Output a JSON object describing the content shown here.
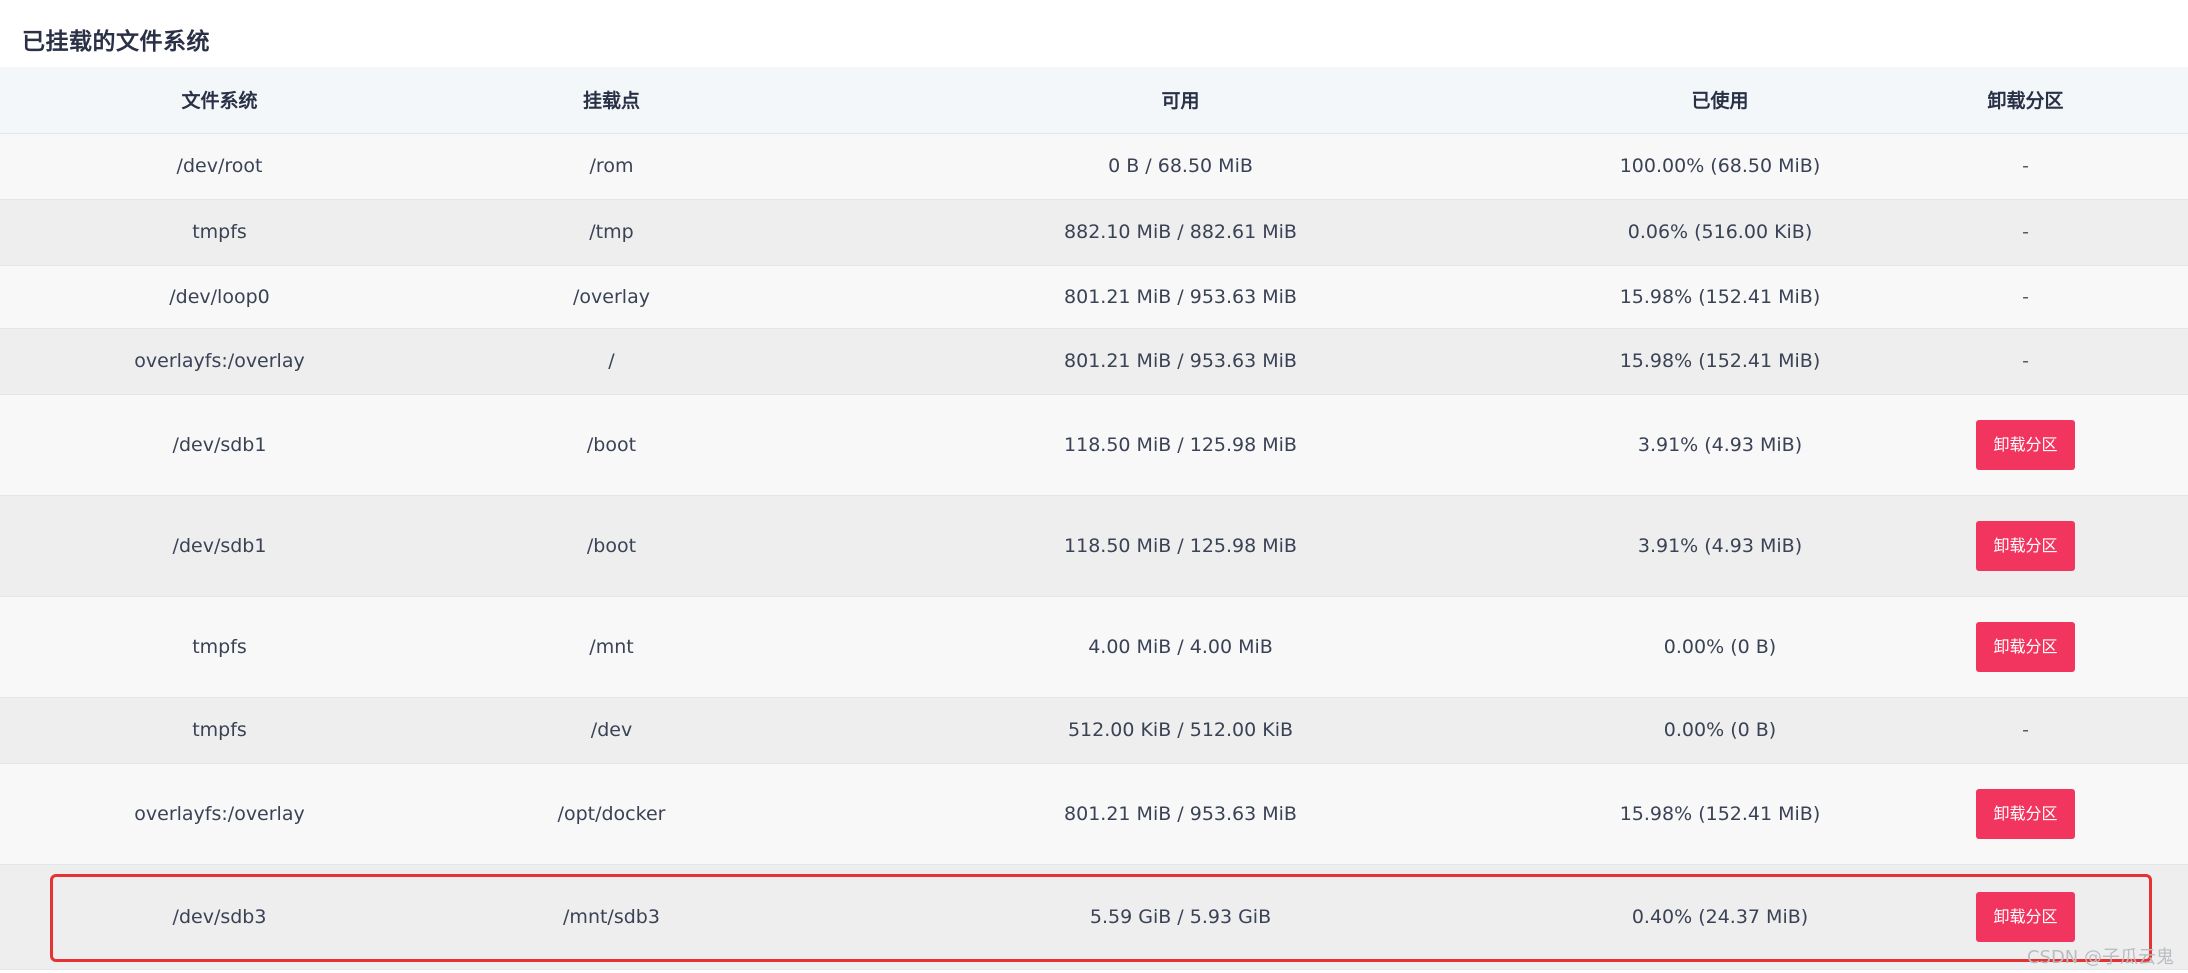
{
  "section_title": "已挂载的文件系统",
  "columns": [
    "文件系统",
    "挂载点",
    "可用",
    "已使用",
    "卸载分区"
  ],
  "rows": [
    {
      "fs": "/dev/root",
      "mount": "/rom",
      "avail": "0 B / 68.50 MiB",
      "used": "100.00% (68.50 MiB)",
      "action": "-",
      "height": 66,
      "shade": "light"
    },
    {
      "fs": "tmpfs",
      "mount": "/tmp",
      "avail": "882.10 MiB / 882.61 MiB",
      "used": "0.06% (516.00 KiB)",
      "action": "-",
      "height": 66,
      "shade": "dark"
    },
    {
      "fs": "/dev/loop0",
      "mount": "/overlay",
      "avail": "801.21 MiB / 953.63 MiB",
      "used": "15.98% (152.41 MiB)",
      "action": "-",
      "height": 63,
      "shade": "light"
    },
    {
      "fs": "overlayfs:/overlay",
      "mount": "/",
      "avail": "801.21 MiB / 953.63 MiB",
      "used": "15.98% (152.41 MiB)",
      "action": "-",
      "height": 66,
      "shade": "dark"
    },
    {
      "fs": "/dev/sdb1",
      "mount": "/boot",
      "avail": "118.50 MiB / 125.98 MiB",
      "used": "3.91% (4.93 MiB)",
      "action": "卸载分区",
      "height": 101,
      "shade": "light"
    },
    {
      "fs": "/dev/sdb1",
      "mount": "/boot",
      "avail": "118.50 MiB / 125.98 MiB",
      "used": "3.91% (4.93 MiB)",
      "action": "卸载分区",
      "height": 101,
      "shade": "dark"
    },
    {
      "fs": "tmpfs",
      "mount": "/mnt",
      "avail": "4.00 MiB / 4.00 MiB",
      "used": "0.00% (0 B)",
      "action": "卸载分区",
      "height": 101,
      "shade": "light"
    },
    {
      "fs": "tmpfs",
      "mount": "/dev",
      "avail": "512.00 KiB / 512.00 KiB",
      "used": "0.00% (0 B)",
      "action": "-",
      "height": 66,
      "shade": "dark"
    },
    {
      "fs": "overlayfs:/overlay",
      "mount": "/opt/docker",
      "avail": "801.21 MiB / 953.63 MiB",
      "used": "15.98% (152.41 MiB)",
      "action": "卸载分区",
      "height": 101,
      "shade": "light"
    },
    {
      "fs": "/dev/sdb3",
      "mount": "/mnt/sdb3",
      "avail": "5.59 GiB / 5.93 GiB",
      "used": "0.40% (24.37 MiB)",
      "action": "卸载分区",
      "height": 105,
      "shade": "dark"
    }
  ],
  "watermark": "CSDN @子瓜云鬼"
}
